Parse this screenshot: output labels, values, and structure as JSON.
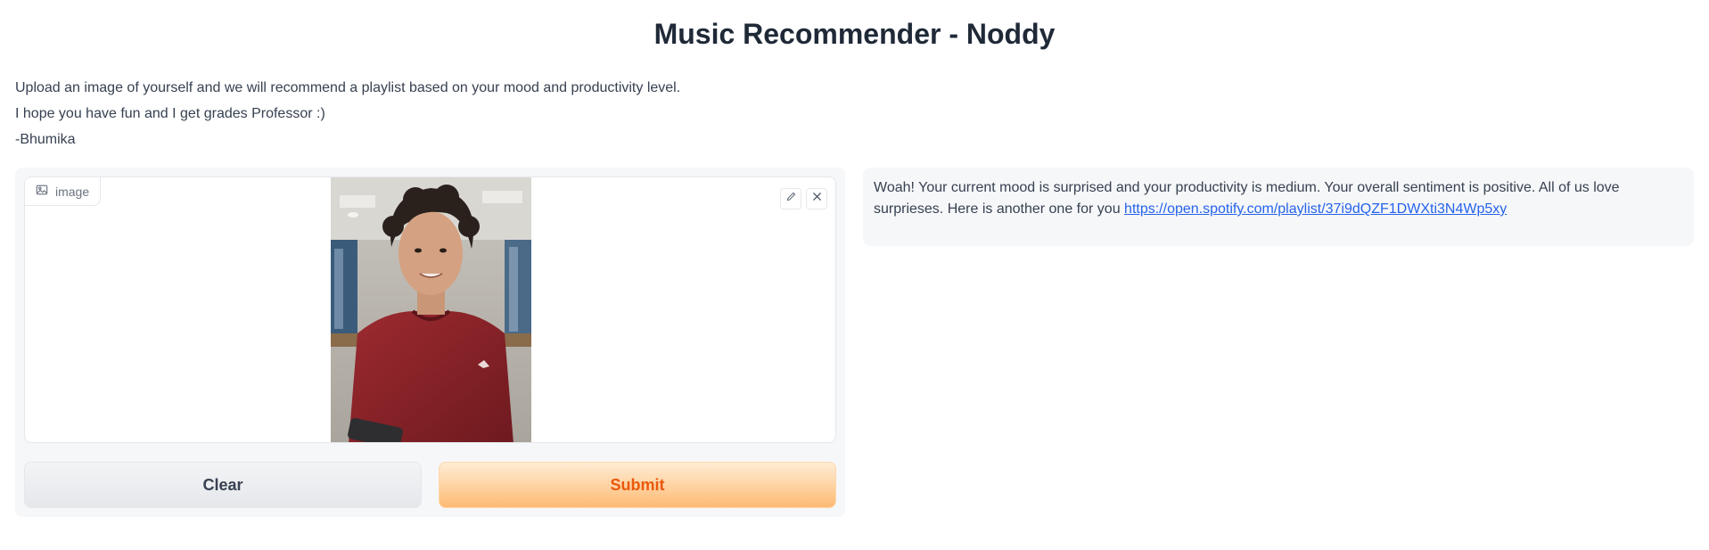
{
  "header": {
    "title": "Music Recommender - Noddy"
  },
  "description": {
    "line1": "Upload an image of yourself and we will recommend a playlist based on your mood and productivity level.",
    "line2": "I hope you have fun and I get grades Professor :)",
    "line3": "-Bhumika"
  },
  "input": {
    "label": "image",
    "label_icon": "image-icon",
    "edit_icon": "pencil-icon",
    "remove_icon": "close-icon"
  },
  "buttons": {
    "clear_label": "Clear",
    "submit_label": "Submit"
  },
  "output": {
    "text": "Woah! Your current mood is surprised and your productivity is medium. Your overall sentiment is positive. All of us love surprieses. Here is another one for you",
    "link_text": "https://open.spotify.com/playlist/37i9dQZF1DWXti3N4Wp5xy",
    "link_href": "https://open.spotify.com/playlist/37i9dQZF1DWXti3N4Wp5xy"
  },
  "colors": {
    "submit_text": "#ea580c",
    "submit_gradient_start": "#ffedd5",
    "submit_gradient_end": "#fdba74",
    "link": "#2563eb",
    "panel_bg": "#f6f7f9"
  }
}
